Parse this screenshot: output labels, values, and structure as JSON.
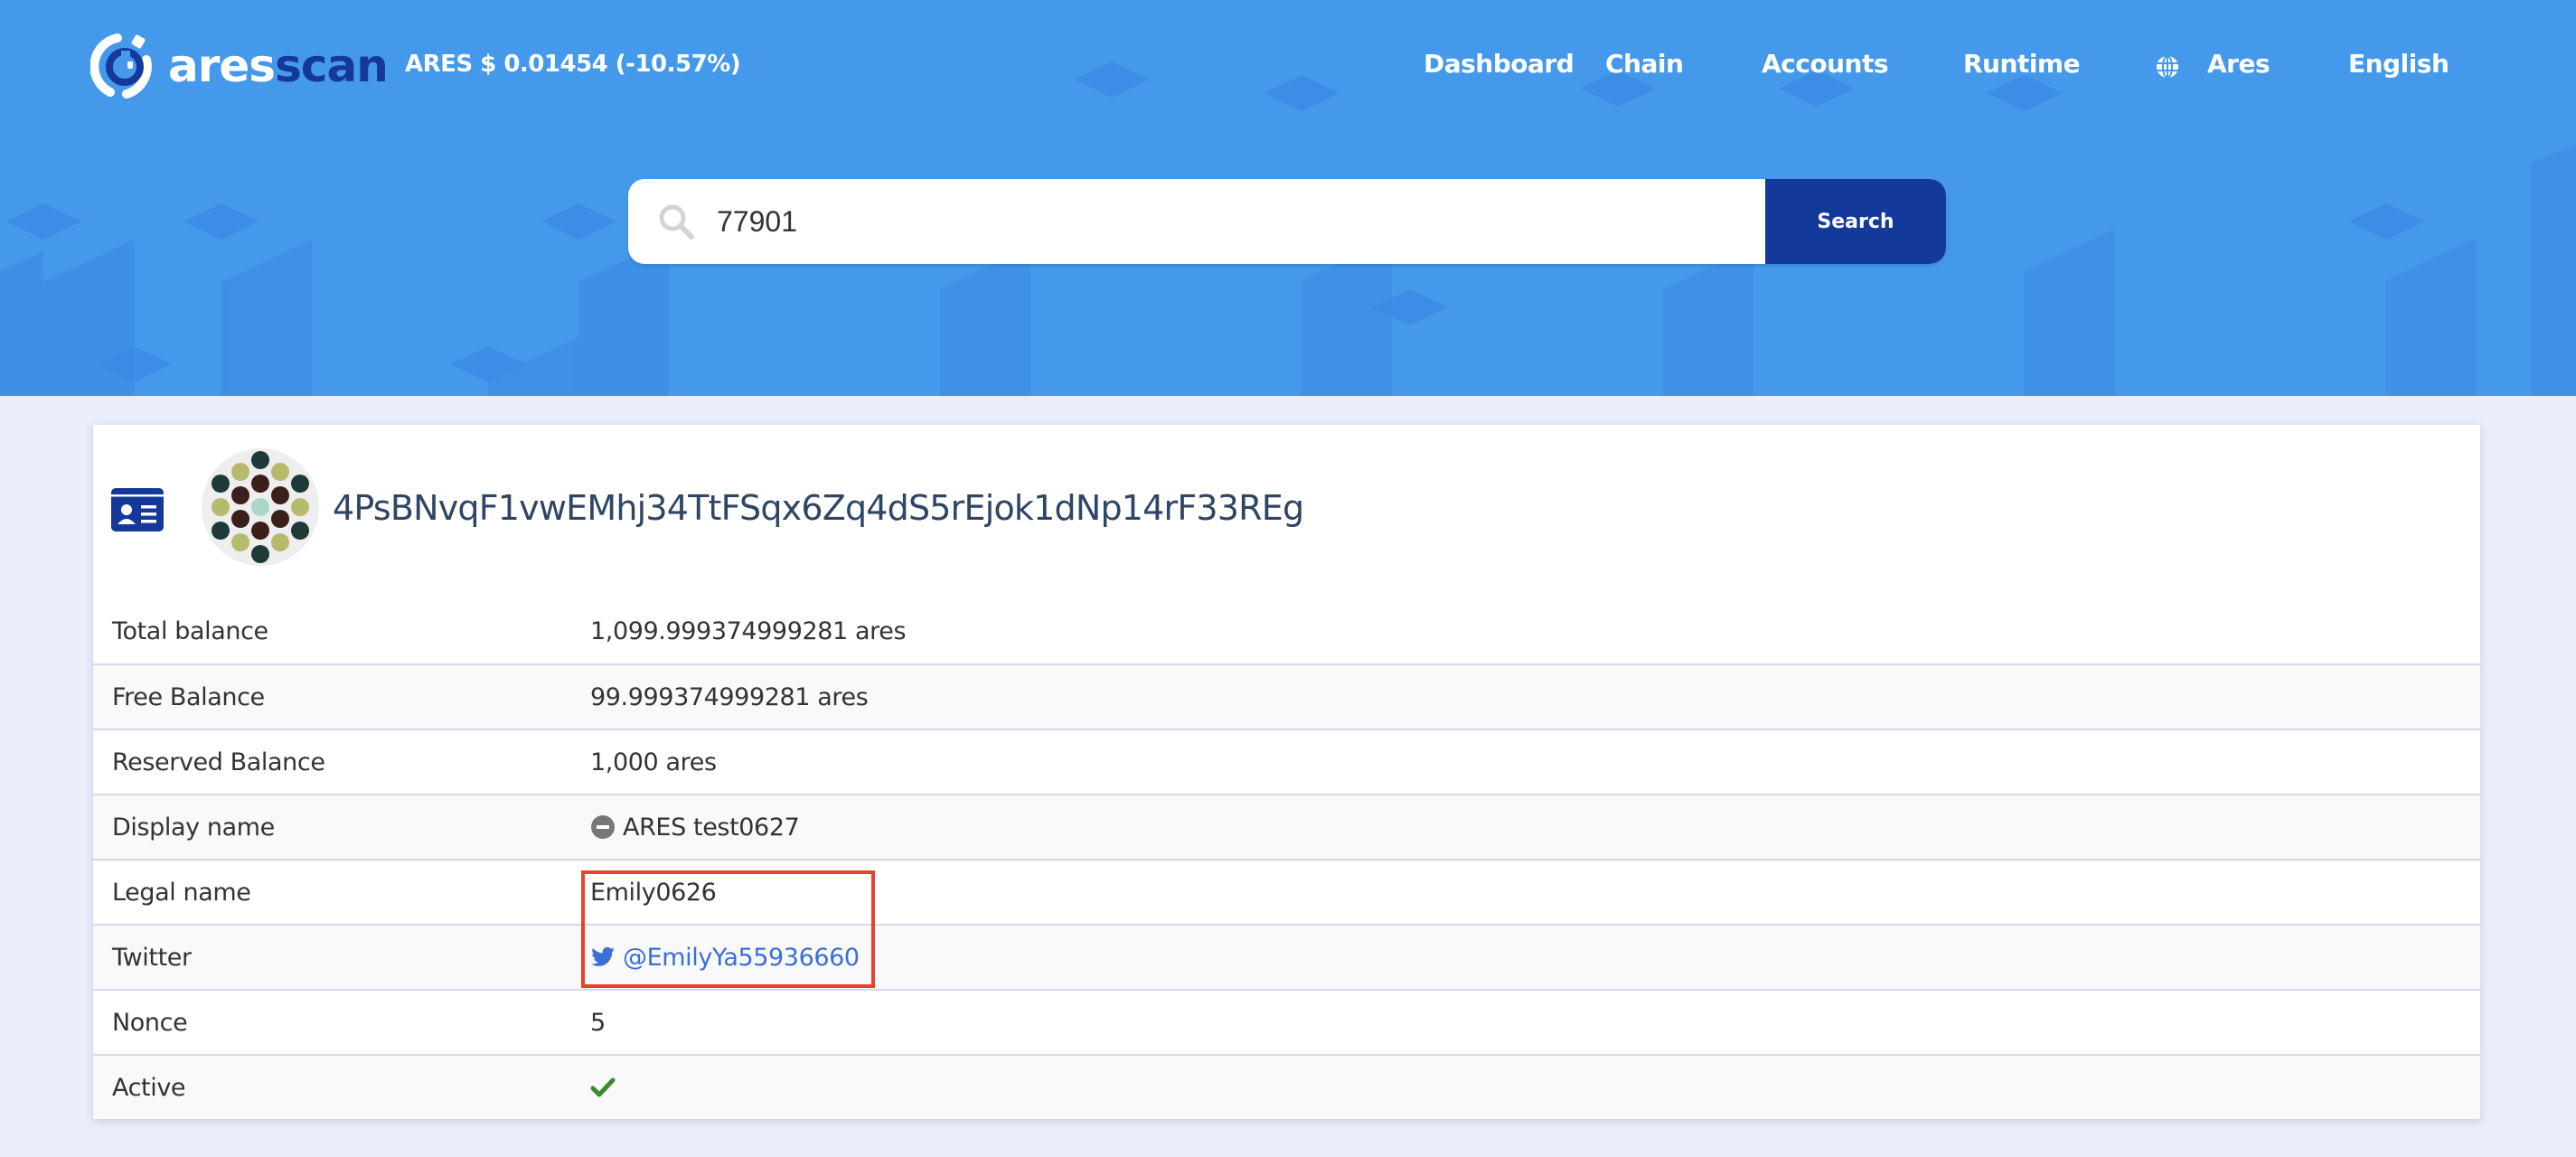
{
  "header": {
    "logo": {
      "part1": "ares",
      "part2": "scan"
    },
    "price_ticker": "ARES $ 0.01454 (-10.57%)",
    "nav": [
      {
        "label": "Dashboard"
      },
      {
        "label": "Chain"
      },
      {
        "label": "Accounts"
      },
      {
        "label": "Runtime"
      },
      {
        "label": "Ares",
        "icon": "globe-icon"
      },
      {
        "label": "English"
      }
    ],
    "search": {
      "value": "77901",
      "placeholder": "",
      "button_label": "Search",
      "icon": "search-icon"
    }
  },
  "account": {
    "icon": "id-card-icon",
    "address": "4PsBNvqF1vwEMhj34TtFSqx6Zq4dS5rEjok1dNp14rF33REg",
    "identicon_colors": {
      "outer": "#1e3a38",
      "olive": "#b5bb6a",
      "inner": "#3a1f1a",
      "center": "#a8d8c8"
    },
    "rows": [
      {
        "label": "Total balance",
        "value": "1,099.999374999281 ares"
      },
      {
        "label": "Free Balance",
        "value": "99.999374999281 ares"
      },
      {
        "label": "Reserved Balance",
        "value": "1,000 ares"
      },
      {
        "label": "Display name",
        "value": "ARES test0627",
        "icon": "minus-circle-icon"
      },
      {
        "label": "Legal name",
        "value": "Emily0626"
      },
      {
        "label": "Twitter",
        "value": "@EmilyYa55936660",
        "icon": "twitter-icon"
      },
      {
        "label": "Nonce",
        "value": "5"
      },
      {
        "label": "Active",
        "value": "",
        "icon": "check-icon",
        "status_color": "#3b8a2e"
      }
    ]
  },
  "colors": {
    "header_bg": "#4599ea",
    "brand_dark": "#13399a",
    "link": "#3a6fd8",
    "highlight": "#e8402a",
    "page_bg": "#eaedfa"
  }
}
